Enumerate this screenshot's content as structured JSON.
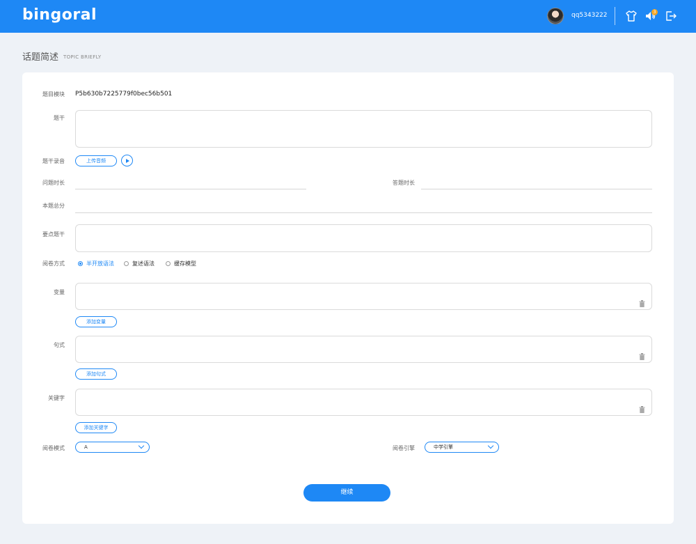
{
  "header": {
    "logo_text": "bingoral",
    "username": "qq5343222",
    "notification_count": "3",
    "brand_color": "#1e88f5"
  },
  "page": {
    "title": "话题简述",
    "subtitle": "TOPIC BRIEFLY"
  },
  "form": {
    "module_label": "题目模块",
    "module_value": "P5b630b7225779f0bec56b501",
    "stem_label": "题干",
    "stem_audio_label": "题干录音",
    "upload_audio_label": "上传音频",
    "question_duration_label": "问题时长",
    "answer_duration_label": "答题时长",
    "total_score_label": "本题总分",
    "key_points_label": "要点题干",
    "grading_method_label": "阅卷方式",
    "grading_methods": [
      "半开放语法",
      "复述语法",
      "缓存模型"
    ],
    "selected_grading_method": "半开放语法",
    "variables_label": "变量",
    "add_variable_label": "添加变量",
    "sentence_pattern_label": "句式",
    "add_sentence_pattern_label": "添加句式",
    "keywords_label": "关键字",
    "add_keyword_label": "添加关键字",
    "grading_mode_label": "阅卷模式",
    "grading_mode_value": "A",
    "grading_engine_label": "阅卷引擎",
    "grading_engine_value": "中学引擎",
    "continue_label": "继续"
  }
}
